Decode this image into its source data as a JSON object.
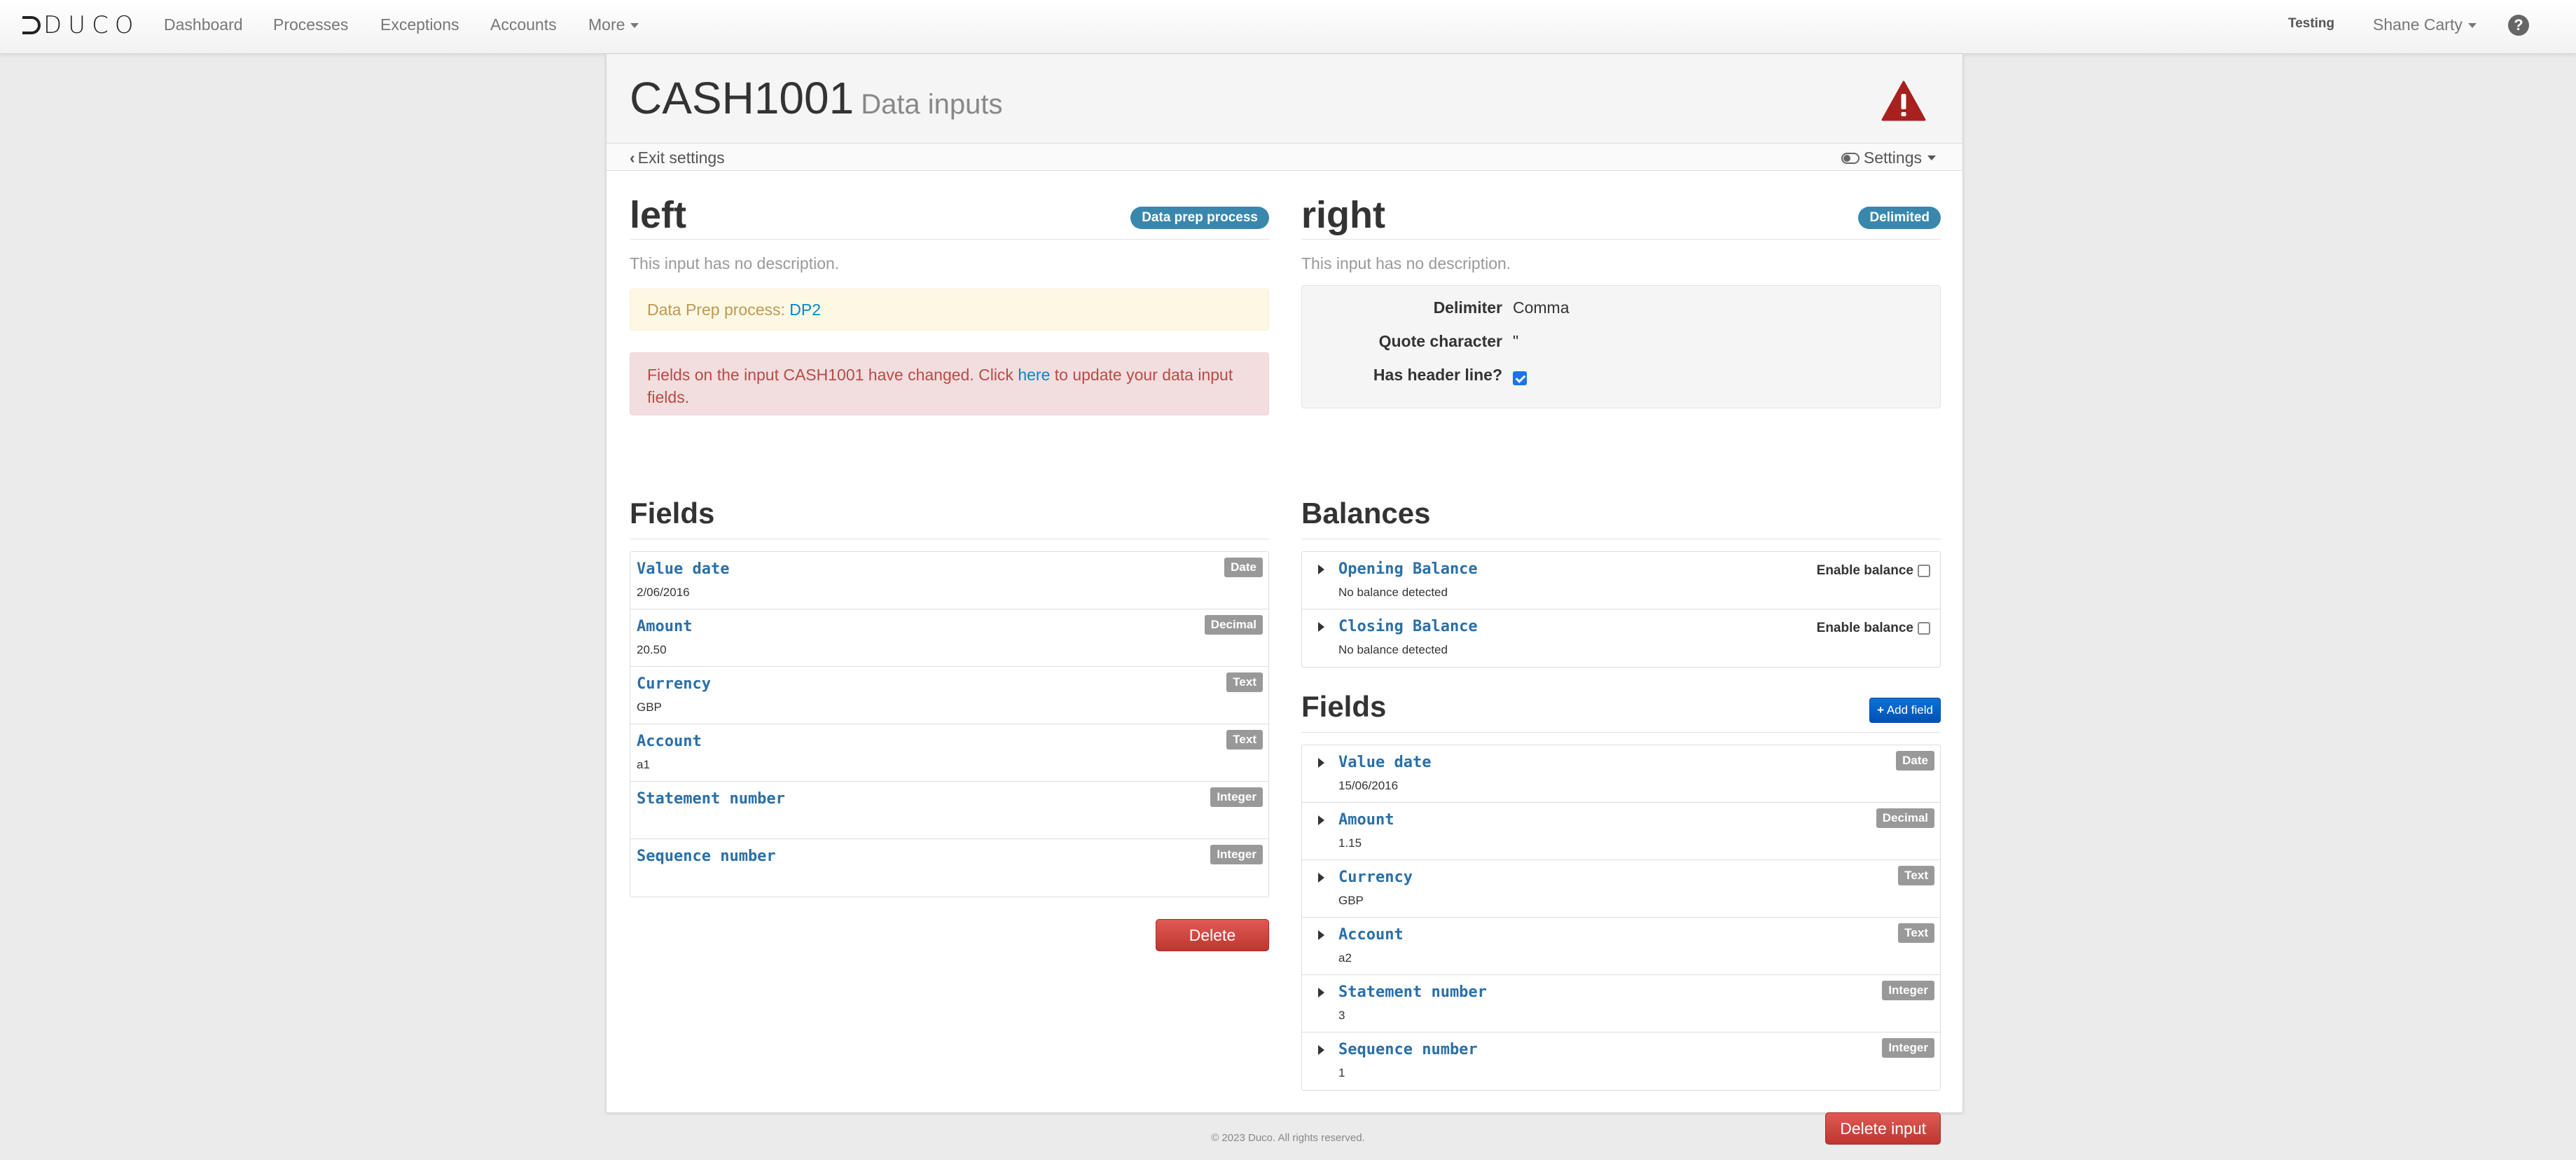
{
  "nav": {
    "logo": "DUCO",
    "items": [
      "Dashboard",
      "Processes",
      "Exceptions",
      "Accounts"
    ],
    "more": "More",
    "environment": "Testing",
    "user": "Shane Carty"
  },
  "page": {
    "title": "CASH1001",
    "subtitle": "Data inputs",
    "exit_label": "Exit settings",
    "settings_label": "Settings"
  },
  "left": {
    "title": "left",
    "badge": "Data prep process",
    "description": "This input has no description.",
    "dp_label": "Data Prep process:",
    "dp_link": "DP2",
    "alert_pre": "Fields on the input CASH1001 have changed. Click",
    "alert_link": "here",
    "alert_post": "to update your data input fields.",
    "fields_title": "Fields",
    "fields": [
      {
        "name": "Value date",
        "value": "2/06/2016",
        "type": "Date"
      },
      {
        "name": "Amount",
        "value": "20.50",
        "type": "Decimal"
      },
      {
        "name": "Currency",
        "value": "GBP",
        "type": "Text"
      },
      {
        "name": "Account",
        "value": "a1",
        "type": "Text"
      },
      {
        "name": "Statement number",
        "value": "",
        "type": "Integer"
      },
      {
        "name": "Sequence number",
        "value": "",
        "type": "Integer"
      }
    ],
    "delete_label": "Delete input"
  },
  "right": {
    "title": "right",
    "badge": "Delimited",
    "description": "This input has no description.",
    "props": {
      "delimiter_label": "Delimiter",
      "delimiter_value": "Comma",
      "quote_label": "Quote character",
      "quote_value": "\"",
      "header_label": "Has header line?",
      "header_checked": true
    },
    "balances_title": "Balances",
    "balances": [
      {
        "name": "Opening Balance",
        "status": "No balance detected",
        "enable_label": "Enable balance",
        "enabled": false
      },
      {
        "name": "Closing Balance",
        "status": "No balance detected",
        "enable_label": "Enable balance",
        "enabled": false
      }
    ],
    "fields_title": "Fields",
    "add_field_label": "Add field",
    "fields": [
      {
        "name": "Value date",
        "value": "15/06/2016",
        "type": "Date"
      },
      {
        "name": "Amount",
        "value": "1.15",
        "type": "Decimal"
      },
      {
        "name": "Currency",
        "value": "GBP",
        "type": "Text"
      },
      {
        "name": "Account",
        "value": "a2",
        "type": "Text"
      },
      {
        "name": "Statement number",
        "value": "3",
        "type": "Integer"
      },
      {
        "name": "Sequence number",
        "value": "1",
        "type": "Integer"
      }
    ],
    "delete_label": "Delete input"
  },
  "footer": "© 2023 Duco. All rights reserved.",
  "colors": {
    "badge_blue": "#3a87ad",
    "danger": "#bd362f",
    "primary": "#0050b3",
    "field_name": "#2a6fa8",
    "type_badge": "#999999",
    "warning_icon": "#a7211e"
  },
  "icons": [
    "logo-mark-icon",
    "chevron-left-icon",
    "toggle-icon",
    "warning-triangle-icon",
    "question-circle-icon",
    "caret-right-icon",
    "plus-icon"
  ]
}
